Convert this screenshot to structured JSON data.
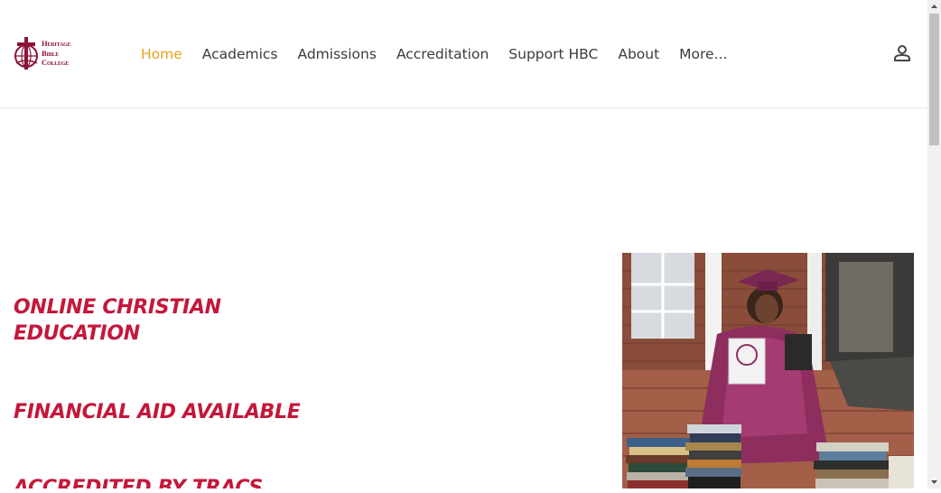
{
  "logo": {
    "lines": [
      "Heritage",
      "Bible",
      "College"
    ],
    "icon": "cross-globe-logo"
  },
  "nav": {
    "items": [
      "Home",
      "Academics",
      "Admissions",
      "Accreditation",
      "Support HBC",
      "About",
      "More..."
    ],
    "active": "Home"
  },
  "header": {
    "user_icon": "user-account-icon"
  },
  "hero": {
    "line1": "ONLINE CHRISTIAN EDUCATION",
    "line2": "FINANCIAL AID AVAILABLE",
    "line3": "ACCREDITED BY TRACS"
  },
  "photo": {
    "subject": "graduate-in-maroon-gown-with-books"
  },
  "colors": {
    "accent": "#e8a21a",
    "brand": "#8b1538",
    "hero_text": "#c4173a",
    "nav_text": "#3b3b3b"
  }
}
